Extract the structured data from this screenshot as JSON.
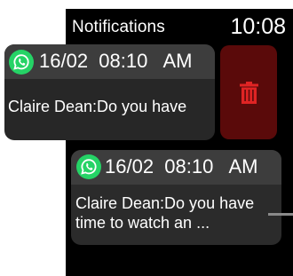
{
  "screen": {
    "title": "Notifications",
    "time": "10:08"
  },
  "notifications": [
    {
      "app_icon": "whatsapp-icon",
      "date": "16/02",
      "time": "08:10",
      "ampm": "AM",
      "header": "16/02  08:10   AM",
      "message": "Claire Dean:Do you have"
    },
    {
      "app_icon": "whatsapp-icon",
      "date": "16/02",
      "time": "08:10",
      "ampm": "AM",
      "header": "16/02  08:10   AM",
      "message": "Claire Dean:Do you have time to watch an ..."
    }
  ],
  "delete_action": {
    "icon": "trash-icon",
    "color": "#e02424"
  },
  "colors": {
    "background": "#000000",
    "card": "#2b2b2b",
    "card_header": "#3d3d3d",
    "whatsapp_green": "#25d366",
    "delete_bg": "#5a0a0a"
  }
}
